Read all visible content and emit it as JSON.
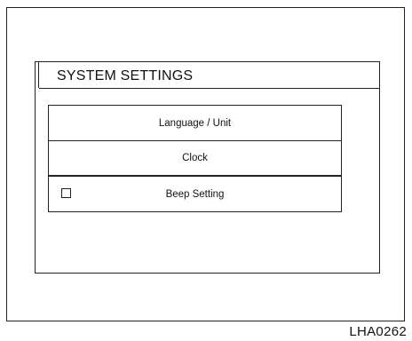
{
  "dialog": {
    "title": "SYSTEM SETTINGS"
  },
  "menu": {
    "items": [
      {
        "label": "Language / Unit"
      },
      {
        "label": "Clock"
      },
      {
        "label": "Beep Setting",
        "checked": false
      }
    ]
  },
  "figure_code": "LHA0262"
}
